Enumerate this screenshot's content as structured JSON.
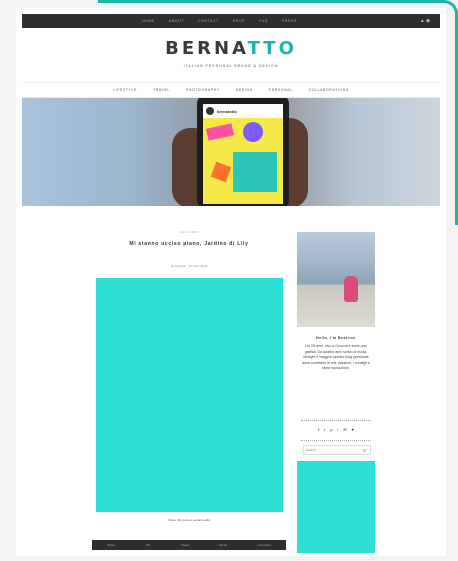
{
  "topnav": [
    "Home",
    "About",
    "Contact",
    "Shop",
    "FAQ",
    "Press"
  ],
  "logo": {
    "part1": "BERNA",
    "part2": "TTO"
  },
  "tagline": "Italian Personal Brand & Design",
  "mainnav": [
    "Lifestyle",
    "Travel",
    "Photography",
    "Design",
    "Personal",
    "Collaborations"
  ],
  "hero": {
    "app_name": "bernatotto"
  },
  "post": {
    "date": "April 2018",
    "title": "Mi stanno ucciso piano, Jardino di Lily",
    "meta": "by Lucia Gt · 12 Comments",
    "caption": "Share this post on social media",
    "bar": [
      "Share",
      "Pin",
      "Tweet",
      "Email",
      "Comment"
    ]
  },
  "sidebar": {
    "title": "Hello, I'm Beatrice",
    "bio": "Ho 28 anni, vivo a Genova e sono una grafica. Da quattro anni scrivo di moda, lifestyle e viaggi in questo blog personale dove condivido le mie passioni, i consigli e tanta ispirazione.",
    "social": [
      "f",
      "t",
      "p",
      "i",
      "✉",
      "♥"
    ],
    "search_placeholder": "Search..."
  },
  "colors": {
    "accent": "#1bb5ad",
    "teal_block": "#2edfd3",
    "dark_bar": "#2e2e2e"
  }
}
